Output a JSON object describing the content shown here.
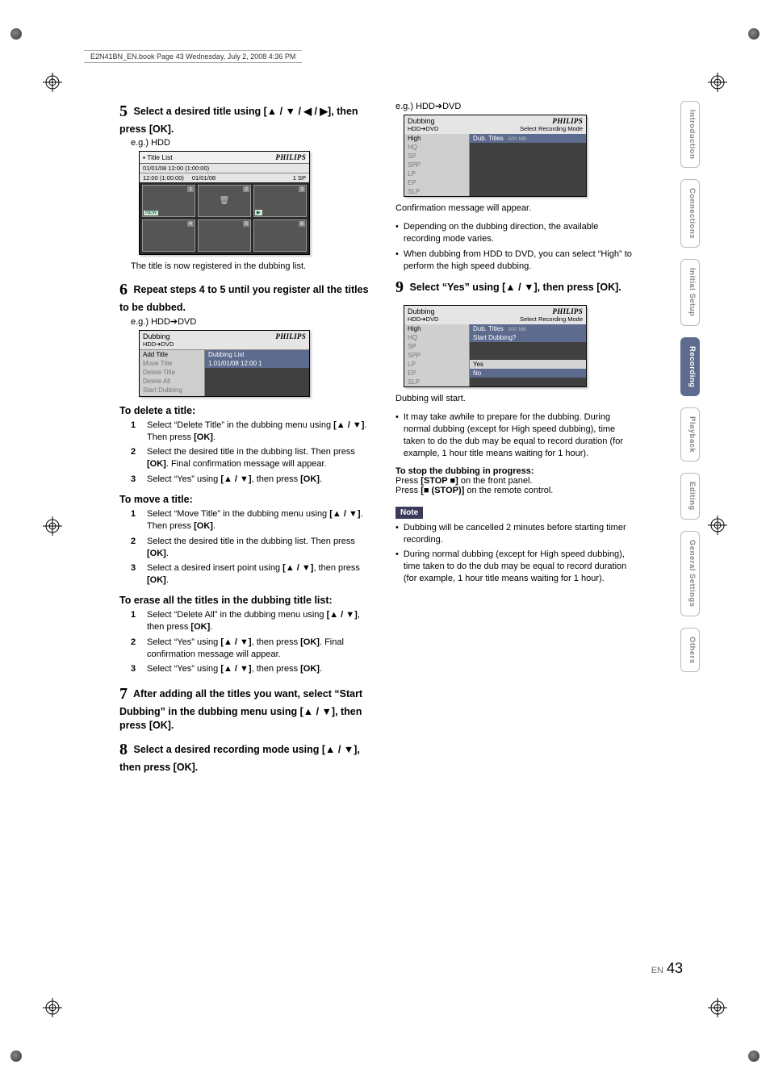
{
  "folio_text": "E2N41BN_EN.book  Page 43  Wednesday, July 2, 2008  4:36 PM",
  "tabs": [
    "Introduction",
    "Connections",
    "Initial Setup",
    "Recording",
    "Playback",
    "Editing",
    "General Settings",
    "Others"
  ],
  "active_tab_index": 3,
  "pagenum_label": "EN",
  "pagenum_value": "43",
  "left": {
    "step5_num": "5",
    "step5_heading": "Select a desired title using [▲ / ▼ / ◀ / ▶], then press [OK].",
    "step5_eg": "e.g.) HDD",
    "osd1": {
      "title_left": "Title List",
      "brand": "PHILIPS",
      "line1": "01/01/08 12:00 (1:00:00)",
      "line2_left": "12:00 (1:00:00)",
      "line2_mid": "01/01/08",
      "line2_right": "1 SP",
      "tiles": [
        {
          "num": "1",
          "badge": "NEW"
        },
        {
          "num": "2",
          "trash": true
        },
        {
          "num": "3",
          "badge": "▶"
        },
        {
          "num": "4"
        },
        {
          "num": "5"
        },
        {
          "num": "6"
        }
      ]
    },
    "caption5": "The title is now registered in the dubbing list.",
    "step6_num": "6",
    "step6_heading": "Repeat steps 4 to 5 until you register all the titles to be dubbed.",
    "step6_eg": "e.g.) HDD➔DVD",
    "osd2": {
      "title_left": "Dubbing",
      "sub": "HDD➔DVD",
      "brand": "PHILIPS",
      "rows": [
        {
          "l": "Add Title",
          "r": "Dubbing List",
          "lsel": true,
          "rsel": true
        },
        {
          "l": "Move Title",
          "r": "1.01/01/08  12:00  1",
          "rsel": true
        },
        {
          "l": "Delete Title",
          "r": ""
        },
        {
          "l": "Delete All",
          "r": ""
        },
        {
          "l": "Start Dubbing",
          "r": ""
        },
        {
          "l": "",
          "r": ""
        }
      ]
    },
    "delete_h": "To delete a title:",
    "delete_steps": [
      "Select “Delete Title” in the dubbing menu using [▲ / ▼]. Then press [OK].",
      "Select the desired title in the dubbing list. Then press [OK]. Final confirmation message will appear.",
      "Select “Yes” using [▲ / ▼], then press [OK]."
    ],
    "move_h": "To move a title:",
    "move_steps": [
      "Select “Move Title” in the dubbing menu using [▲ / ▼]. Then press [OK].",
      "Select the desired title in the dubbing list. Then press [OK].",
      "Select a desired insert point using [▲ / ▼], then press [OK]."
    ],
    "erase_h": "To erase all the titles in the dubbing title list:",
    "erase_steps": [
      "Select “Delete All” in the dubbing menu using [▲ / ▼], then press [OK].",
      "Select “Yes” using [▲ / ▼], then press [OK]. Final confirmation message will appear.",
      "Select “Yes” using [▲ / ▼], then press [OK]."
    ],
    "step7_num": "7",
    "step7_heading": "After adding all the titles you want, select “Start Dubbing” in the dubbing menu using [▲ / ▼], then press [OK].",
    "step8_num": "8",
    "step8_heading": "Select a desired recording mode using [▲ / ▼], then press [OK]."
  },
  "right": {
    "eg": "e.g.) HDD➔DVD",
    "osd3": {
      "title_left": "Dubbing",
      "sub": "HDD➔DVD",
      "sub_right": "Select Recording Mode",
      "brand": "PHILIPS",
      "modes": [
        "High",
        "HQ",
        "SP",
        "SPP",
        "LP",
        "EP",
        "SLP"
      ],
      "sel": 0,
      "right_label": "Dub. Titles",
      "right_tiny": "500 MB"
    },
    "confirm_line": "Confirmation message will appear.",
    "bullets1": [
      "Depending on the dubbing direction, the available recording mode varies.",
      "When dubbing from HDD to DVD, you can select “High” to perform the high speed dubbing."
    ],
    "step9_num": "9",
    "step9_heading": "Select “Yes” using [▲ / ▼], then press [OK].",
    "osd4": {
      "title_left": "Dubbing",
      "sub": "HDD➔DVD",
      "sub_right": "Select Recording Mode",
      "brand": "PHILIPS",
      "modes": [
        "High",
        "HQ",
        "SP",
        "SPP",
        "LP",
        "EP",
        "SLP"
      ],
      "sel": 0,
      "right_label": "Dub. Titles",
      "right_tiny": "500 MB",
      "right_prompt": "Start Dubbing?",
      "dialog": {
        "yes": "Yes",
        "no": "No"
      }
    },
    "start_line": "Dubbing will start.",
    "bullets2": [
      "It may take awhile to prepare for the dubbing. During normal dubbing (except for High speed dubbing), time taken to do the dub may be equal to record duration (for example, 1 hour title means waiting for 1 hour)."
    ],
    "stop_hdr": "To stop the dubbing in progress:",
    "stop_l1": "Press [STOP ■] on the front panel.",
    "stop_l2": "Press [■ (STOP)] on the remote control.",
    "note_label": "Note",
    "note_bullets": [
      "Dubbing will be cancelled 2 minutes before starting timer recording.",
      "During normal dubbing (except for High speed dubbing), time taken to do the dub may be equal to record duration (for example, 1 hour title means waiting for 1 hour)."
    ]
  }
}
